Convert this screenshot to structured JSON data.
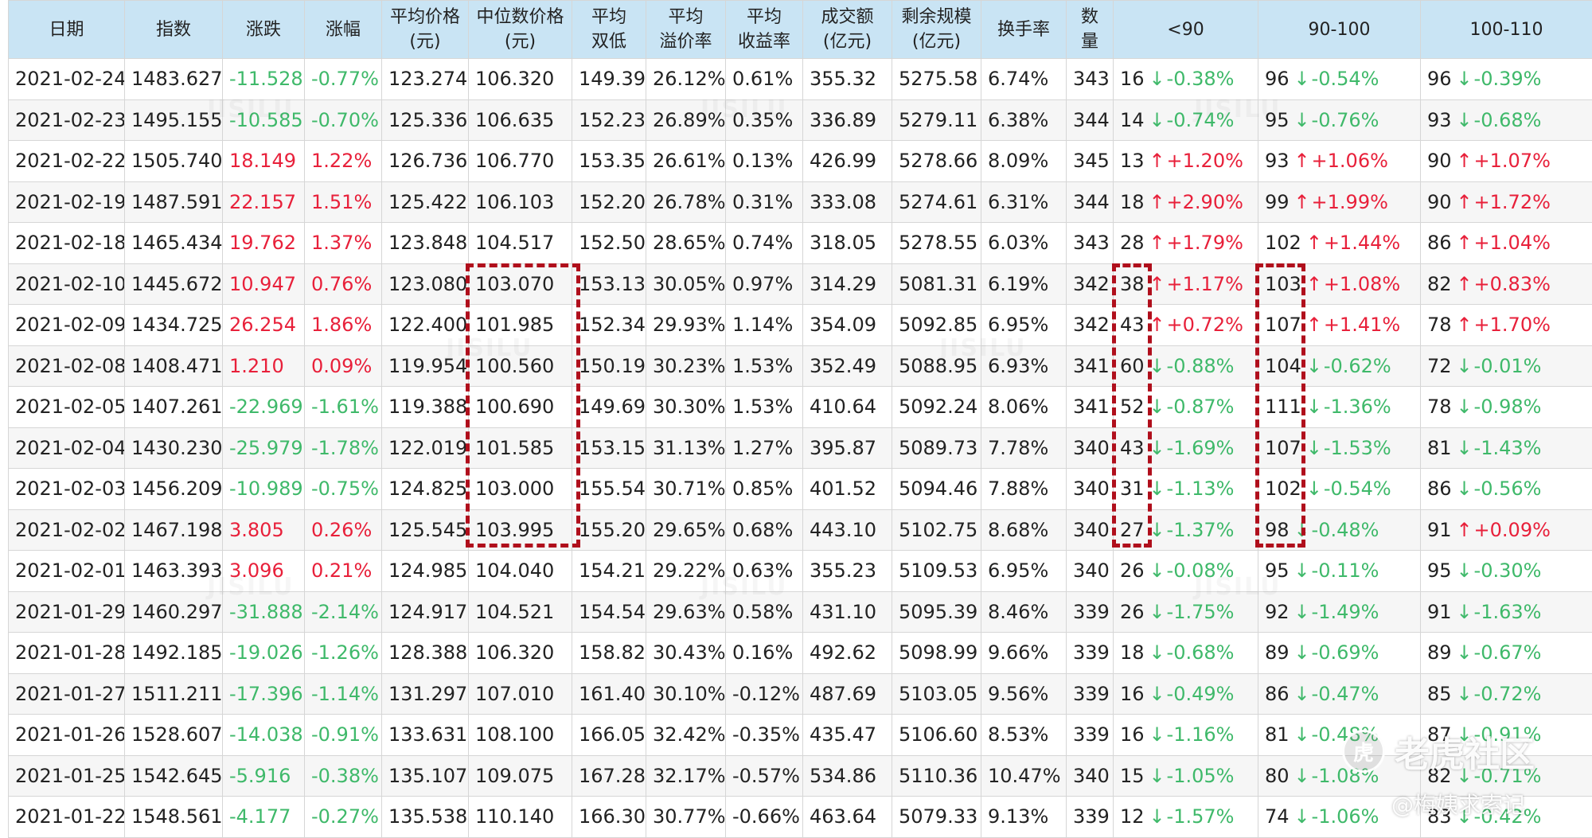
{
  "headers": [
    {
      "l1": "日期",
      "l2": ""
    },
    {
      "l1": "指数",
      "l2": ""
    },
    {
      "l1": "涨跌",
      "l2": ""
    },
    {
      "l1": "涨幅",
      "l2": ""
    },
    {
      "l1": "平均价格",
      "l2": "(元)"
    },
    {
      "l1": "中位数价格",
      "l2": "(元)"
    },
    {
      "l1": "平均",
      "l2": "双低"
    },
    {
      "l1": "平均",
      "l2": "溢价率"
    },
    {
      "l1": "平均",
      "l2": "收益率"
    },
    {
      "l1": "成交额",
      "l2": "(亿元)"
    },
    {
      "l1": "剩余规模",
      "l2": "(亿元)"
    },
    {
      "l1": "换手率",
      "l2": ""
    },
    {
      "l1": "数",
      "l2": "量"
    },
    {
      "l1": "<90",
      "l2": ""
    },
    {
      "l1": "90-100",
      "l2": ""
    },
    {
      "l1": "100-110",
      "l2": ""
    }
  ],
  "rows": [
    {
      "date": "2021-02-24",
      "index": "1483.627",
      "chg": "-11.528",
      "chg_pct": "-0.77%",
      "avg_price": "123.274",
      "median_price": "106.320",
      "avg_double_low": "149.39",
      "avg_premium": "26.12%",
      "avg_yield": "0.61%",
      "turnover_amt": "355.32",
      "remaining": "5275.58",
      "turnover_rate": "6.74%",
      "count": "343",
      "b90": {
        "n": "16",
        "dir": "down",
        "pct": "-0.38%"
      },
      "b90_100": {
        "n": "96",
        "dir": "down",
        "pct": "-0.54%"
      },
      "b100_110": {
        "n": "96",
        "dir": "down",
        "pct": "-0.39%"
      }
    },
    {
      "date": "2021-02-23",
      "index": "1495.155",
      "chg": "-10.585",
      "chg_pct": "-0.70%",
      "avg_price": "125.336",
      "median_price": "106.635",
      "avg_double_low": "152.23",
      "avg_premium": "26.89%",
      "avg_yield": "0.35%",
      "turnover_amt": "336.89",
      "remaining": "5279.11",
      "turnover_rate": "6.38%",
      "count": "344",
      "b90": {
        "n": "14",
        "dir": "down",
        "pct": "-0.74%"
      },
      "b90_100": {
        "n": "95",
        "dir": "down",
        "pct": "-0.76%"
      },
      "b100_110": {
        "n": "93",
        "dir": "down",
        "pct": "-0.68%"
      }
    },
    {
      "date": "2021-02-22",
      "index": "1505.740",
      "chg": "18.149",
      "chg_pct": "1.22%",
      "avg_price": "126.736",
      "median_price": "106.770",
      "avg_double_low": "153.35",
      "avg_premium": "26.61%",
      "avg_yield": "0.13%",
      "turnover_amt": "426.99",
      "remaining": "5278.66",
      "turnover_rate": "8.09%",
      "count": "345",
      "b90": {
        "n": "13",
        "dir": "up",
        "pct": "+1.20%"
      },
      "b90_100": {
        "n": "93",
        "dir": "up",
        "pct": "+1.06%"
      },
      "b100_110": {
        "n": "90",
        "dir": "up",
        "pct": "+1.07%"
      }
    },
    {
      "date": "2021-02-19",
      "index": "1487.591",
      "chg": "22.157",
      "chg_pct": "1.51%",
      "avg_price": "125.422",
      "median_price": "106.103",
      "avg_double_low": "152.20",
      "avg_premium": "26.78%",
      "avg_yield": "0.31%",
      "turnover_amt": "333.08",
      "remaining": "5274.61",
      "turnover_rate": "6.31%",
      "count": "344",
      "b90": {
        "n": "18",
        "dir": "up",
        "pct": "+2.90%"
      },
      "b90_100": {
        "n": "99",
        "dir": "up",
        "pct": "+1.99%"
      },
      "b100_110": {
        "n": "90",
        "dir": "up",
        "pct": "+1.72%"
      }
    },
    {
      "date": "2021-02-18",
      "index": "1465.434",
      "chg": "19.762",
      "chg_pct": "1.37%",
      "avg_price": "123.848",
      "median_price": "104.517",
      "avg_double_low": "152.50",
      "avg_premium": "28.65%",
      "avg_yield": "0.74%",
      "turnover_amt": "318.05",
      "remaining": "5278.55",
      "turnover_rate": "6.03%",
      "count": "343",
      "b90": {
        "n": "28",
        "dir": "up",
        "pct": "+1.79%"
      },
      "b90_100": {
        "n": "102",
        "dir": "up",
        "pct": "+1.44%"
      },
      "b100_110": {
        "n": "86",
        "dir": "up",
        "pct": "+1.04%"
      }
    },
    {
      "date": "2021-02-10",
      "index": "1445.672",
      "chg": "10.947",
      "chg_pct": "0.76%",
      "avg_price": "123.080",
      "median_price": "103.070",
      "avg_double_low": "153.13",
      "avg_premium": "30.05%",
      "avg_yield": "0.97%",
      "turnover_amt": "314.29",
      "remaining": "5081.31",
      "turnover_rate": "6.19%",
      "count": "342",
      "b90": {
        "n": "38",
        "dir": "up",
        "pct": "+1.17%"
      },
      "b90_100": {
        "n": "103",
        "dir": "up",
        "pct": "+1.08%"
      },
      "b100_110": {
        "n": "82",
        "dir": "up",
        "pct": "+0.83%"
      }
    },
    {
      "date": "2021-02-09",
      "index": "1434.725",
      "chg": "26.254",
      "chg_pct": "1.86%",
      "avg_price": "122.400",
      "median_price": "101.985",
      "avg_double_low": "152.34",
      "avg_premium": "29.93%",
      "avg_yield": "1.14%",
      "turnover_amt": "354.09",
      "remaining": "5092.85",
      "turnover_rate": "6.95%",
      "count": "342",
      "b90": {
        "n": "43",
        "dir": "up",
        "pct": "+0.72%"
      },
      "b90_100": {
        "n": "107",
        "dir": "up",
        "pct": "+1.41%"
      },
      "b100_110": {
        "n": "78",
        "dir": "up",
        "pct": "+1.70%"
      }
    },
    {
      "date": "2021-02-08",
      "index": "1408.471",
      "chg": "1.210",
      "chg_pct": "0.09%",
      "avg_price": "119.954",
      "median_price": "100.560",
      "avg_double_low": "150.19",
      "avg_premium": "30.23%",
      "avg_yield": "1.53%",
      "turnover_amt": "352.49",
      "remaining": "5088.95",
      "turnover_rate": "6.93%",
      "count": "341",
      "b90": {
        "n": "60",
        "dir": "down",
        "pct": "-0.88%"
      },
      "b90_100": {
        "n": "104",
        "dir": "down",
        "pct": "-0.62%"
      },
      "b100_110": {
        "n": "72",
        "dir": "down",
        "pct": "-0.01%"
      }
    },
    {
      "date": "2021-02-05",
      "index": "1407.261",
      "chg": "-22.969",
      "chg_pct": "-1.61%",
      "avg_price": "119.388",
      "median_price": "100.690",
      "avg_double_low": "149.69",
      "avg_premium": "30.30%",
      "avg_yield": "1.53%",
      "turnover_amt": "410.64",
      "remaining": "5092.24",
      "turnover_rate": "8.06%",
      "count": "341",
      "b90": {
        "n": "52",
        "dir": "down",
        "pct": "-0.87%"
      },
      "b90_100": {
        "n": "111",
        "dir": "down",
        "pct": "-1.36%"
      },
      "b100_110": {
        "n": "78",
        "dir": "down",
        "pct": "-0.98%"
      }
    },
    {
      "date": "2021-02-04",
      "index": "1430.230",
      "chg": "-25.979",
      "chg_pct": "-1.78%",
      "avg_price": "122.019",
      "median_price": "101.585",
      "avg_double_low": "153.15",
      "avg_premium": "31.13%",
      "avg_yield": "1.27%",
      "turnover_amt": "395.87",
      "remaining": "5089.73",
      "turnover_rate": "7.78%",
      "count": "340",
      "b90": {
        "n": "43",
        "dir": "down",
        "pct": "-1.69%"
      },
      "b90_100": {
        "n": "107",
        "dir": "down",
        "pct": "-1.53%"
      },
      "b100_110": {
        "n": "81",
        "dir": "down",
        "pct": "-1.43%"
      }
    },
    {
      "date": "2021-02-03",
      "index": "1456.209",
      "chg": "-10.989",
      "chg_pct": "-0.75%",
      "avg_price": "124.825",
      "median_price": "103.000",
      "avg_double_low": "155.54",
      "avg_premium": "30.71%",
      "avg_yield": "0.85%",
      "turnover_amt": "401.52",
      "remaining": "5094.46",
      "turnover_rate": "7.88%",
      "count": "340",
      "b90": {
        "n": "31",
        "dir": "down",
        "pct": "-1.13%"
      },
      "b90_100": {
        "n": "102",
        "dir": "down",
        "pct": "-0.54%"
      },
      "b100_110": {
        "n": "86",
        "dir": "down",
        "pct": "-0.56%"
      }
    },
    {
      "date": "2021-02-02",
      "index": "1467.198",
      "chg": "3.805",
      "chg_pct": "0.26%",
      "avg_price": "125.545",
      "median_price": "103.995",
      "avg_double_low": "155.20",
      "avg_premium": "29.65%",
      "avg_yield": "0.68%",
      "turnover_amt": "443.10",
      "remaining": "5102.75",
      "turnover_rate": "8.68%",
      "count": "340",
      "b90": {
        "n": "27",
        "dir": "down",
        "pct": "-1.37%"
      },
      "b90_100": {
        "n": "98",
        "dir": "down",
        "pct": "-0.48%"
      },
      "b100_110": {
        "n": "91",
        "dir": "up",
        "pct": "+0.09%"
      }
    },
    {
      "date": "2021-02-01",
      "index": "1463.393",
      "chg": "3.096",
      "chg_pct": "0.21%",
      "avg_price": "124.985",
      "median_price": "104.040",
      "avg_double_low": "154.21",
      "avg_premium": "29.22%",
      "avg_yield": "0.63%",
      "turnover_amt": "355.23",
      "remaining": "5109.53",
      "turnover_rate": "6.95%",
      "count": "340",
      "b90": {
        "n": "26",
        "dir": "down",
        "pct": "-0.08%"
      },
      "b90_100": {
        "n": "95",
        "dir": "down",
        "pct": "-0.11%"
      },
      "b100_110": {
        "n": "95",
        "dir": "down",
        "pct": "-0.30%"
      }
    },
    {
      "date": "2021-01-29",
      "index": "1460.297",
      "chg": "-31.888",
      "chg_pct": "-2.14%",
      "avg_price": "124.917",
      "median_price": "104.521",
      "avg_double_low": "154.54",
      "avg_premium": "29.63%",
      "avg_yield": "0.58%",
      "turnover_amt": "431.10",
      "remaining": "5095.39",
      "turnover_rate": "8.46%",
      "count": "339",
      "b90": {
        "n": "26",
        "dir": "down",
        "pct": "-1.75%"
      },
      "b90_100": {
        "n": "92",
        "dir": "down",
        "pct": "-1.49%"
      },
      "b100_110": {
        "n": "91",
        "dir": "down",
        "pct": "-1.63%"
      }
    },
    {
      "date": "2021-01-28",
      "index": "1492.185",
      "chg": "-19.026",
      "chg_pct": "-1.26%",
      "avg_price": "128.388",
      "median_price": "106.320",
      "avg_double_low": "158.82",
      "avg_premium": "30.43%",
      "avg_yield": "0.16%",
      "turnover_amt": "492.62",
      "remaining": "5098.99",
      "turnover_rate": "9.66%",
      "count": "339",
      "b90": {
        "n": "18",
        "dir": "down",
        "pct": "-0.68%"
      },
      "b90_100": {
        "n": "89",
        "dir": "down",
        "pct": "-0.69%"
      },
      "b100_110": {
        "n": "89",
        "dir": "down",
        "pct": "-0.67%"
      }
    },
    {
      "date": "2021-01-27",
      "index": "1511.211",
      "chg": "-17.396",
      "chg_pct": "-1.14%",
      "avg_price": "131.297",
      "median_price": "107.010",
      "avg_double_low": "161.40",
      "avg_premium": "30.10%",
      "avg_yield": "-0.12%",
      "turnover_amt": "487.69",
      "remaining": "5103.05",
      "turnover_rate": "9.56%",
      "count": "339",
      "b90": {
        "n": "16",
        "dir": "down",
        "pct": "-0.49%"
      },
      "b90_100": {
        "n": "86",
        "dir": "down",
        "pct": "-0.47%"
      },
      "b100_110": {
        "n": "85",
        "dir": "down",
        "pct": "-0.72%"
      }
    },
    {
      "date": "2021-01-26",
      "index": "1528.607",
      "chg": "-14.038",
      "chg_pct": "-0.91%",
      "avg_price": "133.631",
      "median_price": "108.100",
      "avg_double_low": "166.05",
      "avg_premium": "32.42%",
      "avg_yield": "-0.35%",
      "turnover_amt": "435.47",
      "remaining": "5106.60",
      "turnover_rate": "8.53%",
      "count": "339",
      "b90": {
        "n": "16",
        "dir": "down",
        "pct": "-1.16%"
      },
      "b90_100": {
        "n": "81",
        "dir": "down",
        "pct": "-0.48%"
      },
      "b100_110": {
        "n": "87",
        "dir": "down",
        "pct": "-0.91%"
      }
    },
    {
      "date": "2021-01-25",
      "index": "1542.645",
      "chg": "-5.916",
      "chg_pct": "-0.38%",
      "avg_price": "135.107",
      "median_price": "109.075",
      "avg_double_low": "167.28",
      "avg_premium": "32.17%",
      "avg_yield": "-0.57%",
      "turnover_amt": "534.86",
      "remaining": "5110.36",
      "turnover_rate": "10.47%",
      "count": "340",
      "b90": {
        "n": "15",
        "dir": "down",
        "pct": "-1.05%"
      },
      "b90_100": {
        "n": "80",
        "dir": "down",
        "pct": "-1.08%"
      },
      "b100_110": {
        "n": "82",
        "dir": "down",
        "pct": "-0.71%"
      }
    },
    {
      "date": "2021-01-22",
      "index": "1548.561",
      "chg": "-4.177",
      "chg_pct": "-0.27%",
      "avg_price": "135.538",
      "median_price": "110.140",
      "avg_double_low": "166.30",
      "avg_premium": "30.77%",
      "avg_yield": "-0.66%",
      "turnover_amt": "463.64",
      "remaining": "5079.33",
      "turnover_rate": "9.13%",
      "count": "339",
      "b90": {
        "n": "12",
        "dir": "down",
        "pct": "-1.57%"
      },
      "b90_100": {
        "n": "74",
        "dir": "down",
        "pct": "-1.06%"
      },
      "b100_110": {
        "n": "83",
        "dir": "down",
        "pct": "-0.42%"
      }
    }
  ],
  "arrows": {
    "up": "↑",
    "down": "↓"
  },
  "colors": {
    "up": "#e8203a",
    "down": "#3fb96a",
    "header_bg": "#c9e4f4",
    "highlight": "#b00f1c"
  },
  "watermark": {
    "logo_icon": "虎",
    "logo_text": "老虎社区",
    "author": "@梅姨求索记"
  }
}
